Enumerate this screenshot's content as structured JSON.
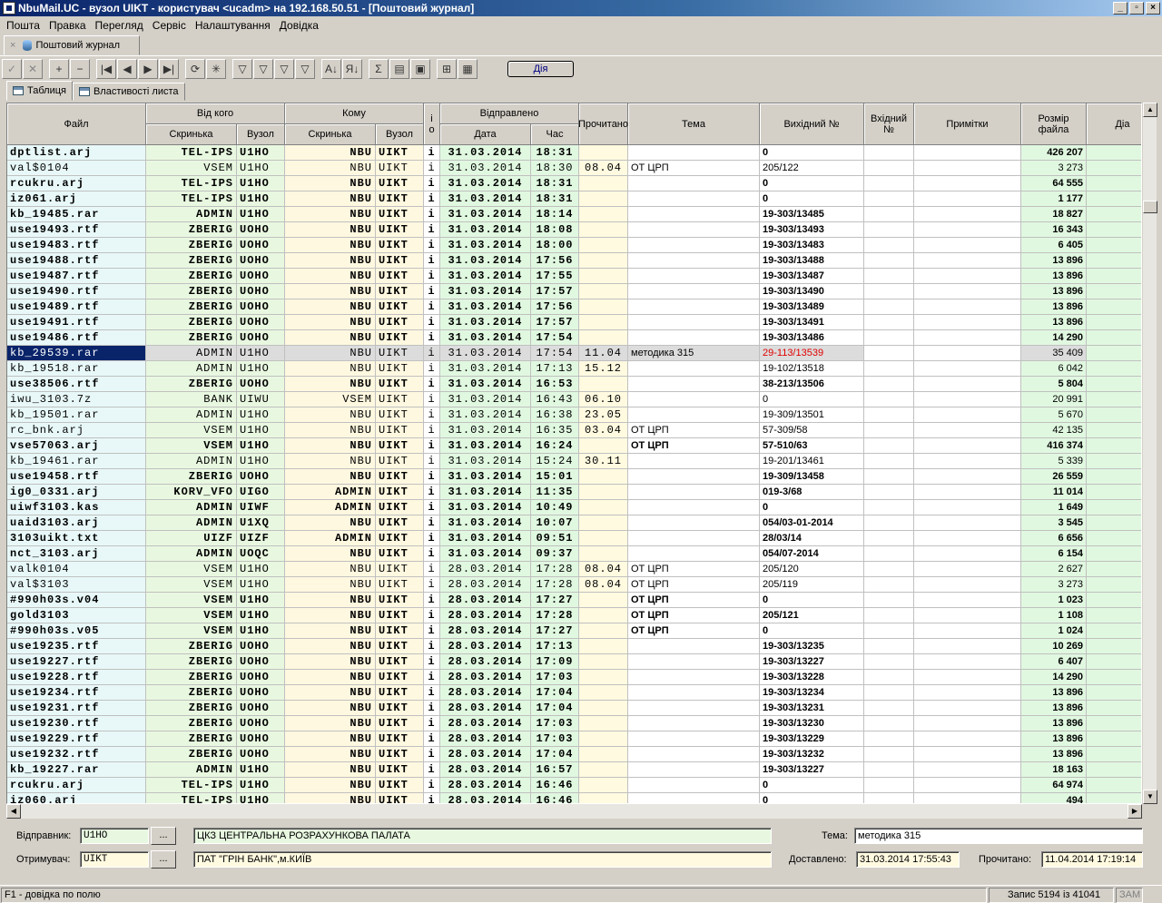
{
  "window": {
    "title": "NbuMail.UC - вузол UIKT - користувач <ucadm> на 192.168.50.51 - [Поштовий журнал]",
    "buttons": [
      "_",
      "▫",
      "×"
    ]
  },
  "menu": [
    "Пошта",
    "Правка",
    "Перегляд",
    "Сервіс",
    "Налаштування",
    "Довідка"
  ],
  "doc_tab": {
    "close": "×",
    "label": "Поштовий журнал"
  },
  "toolbar": {
    "buttons": [
      {
        "icon": "check-icon",
        "glyph": "✓"
      },
      {
        "icon": "cancel-icon",
        "glyph": "✕"
      },
      {
        "icon": "plus-icon",
        "glyph": "+"
      },
      {
        "icon": "minus-icon",
        "glyph": "−"
      },
      {
        "icon": "first-icon",
        "glyph": "|◀"
      },
      {
        "icon": "prev-icon",
        "glyph": "◀"
      },
      {
        "icon": "next-icon",
        "glyph": "▶"
      },
      {
        "icon": "last-icon",
        "glyph": "▶|"
      },
      {
        "icon": "refresh-icon",
        "glyph": "⟳"
      },
      {
        "icon": "star-icon",
        "glyph": "✳"
      },
      {
        "icon": "filter-icon",
        "glyph": "▽"
      },
      {
        "icon": "filter-clear-icon",
        "glyph": "▽"
      },
      {
        "icon": "filter-edit-icon",
        "glyph": "▽"
      },
      {
        "icon": "filter-set-icon",
        "glyph": "▽"
      },
      {
        "icon": "sort-asc-icon",
        "glyph": "A↓"
      },
      {
        "icon": "sort-desc-icon",
        "glyph": "Я↓"
      },
      {
        "icon": "sum-icon",
        "glyph": "Σ"
      },
      {
        "icon": "properties-icon",
        "glyph": "▤"
      },
      {
        "icon": "save-icon",
        "glyph": "▣"
      },
      {
        "icon": "export-icon",
        "glyph": "⊞"
      },
      {
        "icon": "grid-icon",
        "glyph": "▦"
      }
    ],
    "action_label": "Дія"
  },
  "view_tabs": [
    "Таблиця",
    "Властивості листа"
  ],
  "columns": {
    "file": "Файл",
    "from": "Від кого",
    "to": "Кому",
    "io": "і о",
    "sent": "Відправлено",
    "read": "Прочитано",
    "subject": "Тема",
    "out_no": "Вихідний №",
    "in_no": "Вхідний №",
    "notes": "Примітки",
    "size": "Розмір файла",
    "dia": "Діа",
    "box": "Скринька",
    "node": "Вузол",
    "date": "Дата",
    "time": "Час"
  },
  "rows": [
    [
      "dptlist.arj",
      "TEL-IPS",
      "U1HO",
      "NBU",
      "UIKT",
      "i",
      "31.03.2014",
      "18:31",
      "",
      "",
      "0",
      "426 207"
    ],
    [
      "val$0104",
      "VSEM",
      "U1HO",
      "NBU",
      "UIKT",
      "i",
      "31.03.2014",
      "18:30",
      "08.04",
      "ОТ ЦРП",
      "205/122",
      "3 273"
    ],
    [
      "rcukru.arj",
      "TEL-IPS",
      "U1HO",
      "NBU",
      "UIKT",
      "i",
      "31.03.2014",
      "18:31",
      "",
      "",
      "0",
      "64 555"
    ],
    [
      "iz061.arj",
      "TEL-IPS",
      "U1HO",
      "NBU",
      "UIKT",
      "i",
      "31.03.2014",
      "18:31",
      "",
      "",
      "0",
      "1 177"
    ],
    [
      "kb_19485.rar",
      "ADMIN",
      "U1HO",
      "NBU",
      "UIKT",
      "i",
      "31.03.2014",
      "18:14",
      "",
      "",
      "19-303/13485",
      "18 827"
    ],
    [
      "use19493.rtf",
      "ZBERIG",
      "UOHO",
      "NBU",
      "UIKT",
      "i",
      "31.03.2014",
      "18:08",
      "",
      "",
      "19-303/13493",
      "16 343"
    ],
    [
      "use19483.rtf",
      "ZBERIG",
      "UOHO",
      "NBU",
      "UIKT",
      "i",
      "31.03.2014",
      "18:00",
      "",
      "",
      "19-303/13483",
      "6 405"
    ],
    [
      "use19488.rtf",
      "ZBERIG",
      "UOHO",
      "NBU",
      "UIKT",
      "i",
      "31.03.2014",
      "17:56",
      "",
      "",
      "19-303/13488",
      "13 896"
    ],
    [
      "use19487.rtf",
      "ZBERIG",
      "UOHO",
      "NBU",
      "UIKT",
      "i",
      "31.03.2014",
      "17:55",
      "",
      "",
      "19-303/13487",
      "13 896"
    ],
    [
      "use19490.rtf",
      "ZBERIG",
      "UOHO",
      "NBU",
      "UIKT",
      "i",
      "31.03.2014",
      "17:57",
      "",
      "",
      "19-303/13490",
      "13 896"
    ],
    [
      "use19489.rtf",
      "ZBERIG",
      "UOHO",
      "NBU",
      "UIKT",
      "i",
      "31.03.2014",
      "17:56",
      "",
      "",
      "19-303/13489",
      "13 896"
    ],
    [
      "use19491.rtf",
      "ZBERIG",
      "UOHO",
      "NBU",
      "UIKT",
      "i",
      "31.03.2014",
      "17:57",
      "",
      "",
      "19-303/13491",
      "13 896"
    ],
    [
      "use19486.rtf",
      "ZBERIG",
      "UOHO",
      "NBU",
      "UIKT",
      "i",
      "31.03.2014",
      "17:54",
      "",
      "",
      "19-303/13486",
      "14 290"
    ],
    [
      "kb_29539.rar",
      "ADMIN",
      "U1HO",
      "NBU",
      "UIKT",
      "i",
      "31.03.2014",
      "17:54",
      "11.04",
      "методика 315",
      "29-113/13539",
      "35 409"
    ],
    [
      "kb_19518.rar",
      "ADMIN",
      "U1HO",
      "NBU",
      "UIKT",
      "i",
      "31.03.2014",
      "17:13",
      "15.12",
      "",
      "19-102/13518",
      "6 042"
    ],
    [
      "use38506.rtf",
      "ZBERIG",
      "UOHO",
      "NBU",
      "UIKT",
      "i",
      "31.03.2014",
      "16:53",
      "",
      "",
      "38-213/13506",
      "5 804"
    ],
    [
      "iwu_3103.7z",
      "BANK",
      "UIWU",
      "VSEM",
      "UIKT",
      "i",
      "31.03.2014",
      "16:43",
      "06.10",
      "",
      "0",
      "20 991"
    ],
    [
      "kb_19501.rar",
      "ADMIN",
      "U1HO",
      "NBU",
      "UIKT",
      "i",
      "31.03.2014",
      "16:38",
      "23.05",
      "",
      "19-309/13501",
      "5 670"
    ],
    [
      "rc_bnk.arj",
      "VSEM",
      "U1HO",
      "NBU",
      "UIKT",
      "i",
      "31.03.2014",
      "16:35",
      "03.04",
      "ОТ ЦРП",
      "57-309/58",
      "42 135"
    ],
    [
      "vse57063.arj",
      "VSEM",
      "U1HO",
      "NBU",
      "UIKT",
      "i",
      "31.03.2014",
      "16:24",
      "",
      "ОТ ЦРП",
      "57-510/63",
      "416 374"
    ],
    [
      "kb_19461.rar",
      "ADMIN",
      "U1HO",
      "NBU",
      "UIKT",
      "i",
      "31.03.2014",
      "15:24",
      "30.11",
      "",
      "19-201/13461",
      "5 339"
    ],
    [
      "use19458.rtf",
      "ZBERIG",
      "UOHO",
      "NBU",
      "UIKT",
      "i",
      "31.03.2014",
      "15:01",
      "",
      "",
      "19-309/13458",
      "26 559"
    ],
    [
      "ig0_0331.arj",
      "KORV_VFO",
      "UIGO",
      "ADMIN",
      "UIKT",
      "i",
      "31.03.2014",
      "11:35",
      "",
      "",
      "019-3/68",
      "11 014"
    ],
    [
      "uiwf3103.kas",
      "ADMIN",
      "UIWF",
      "ADMIN",
      "UIKT",
      "i",
      "31.03.2014",
      "10:49",
      "",
      "",
      "0",
      "1 649"
    ],
    [
      "uaid3103.arj",
      "ADMIN",
      "U1XQ",
      "NBU",
      "UIKT",
      "i",
      "31.03.2014",
      "10:07",
      "",
      "",
      "054/03-01-2014",
      "3 545"
    ],
    [
      "3103uikt.txt",
      "UIZF",
      "UIZF",
      "ADMIN",
      "UIKT",
      "i",
      "31.03.2014",
      "09:51",
      "",
      "",
      "28/03/14",
      "6 656"
    ],
    [
      "nct_3103.arj",
      "ADMIN",
      "UOQC",
      "NBU",
      "UIKT",
      "i",
      "31.03.2014",
      "09:37",
      "",
      "",
      "054/07-2014",
      "6 154"
    ],
    [
      "valk0104",
      "VSEM",
      "U1HO",
      "NBU",
      "UIKT",
      "i",
      "28.03.2014",
      "17:28",
      "08.04",
      "ОТ ЦРП",
      "205/120",
      "2 627"
    ],
    [
      "val$3103",
      "VSEM",
      "U1HO",
      "NBU",
      "UIKT",
      "i",
      "28.03.2014",
      "17:28",
      "08.04",
      "ОТ ЦРП",
      "205/119",
      "3 273"
    ],
    [
      "#990h03s.v04",
      "VSEM",
      "U1HO",
      "NBU",
      "UIKT",
      "i",
      "28.03.2014",
      "17:27",
      "",
      "ОТ ЦРП",
      "0",
      "1 023"
    ],
    [
      "gold3103",
      "VSEM",
      "U1HO",
      "NBU",
      "UIKT",
      "i",
      "28.03.2014",
      "17:28",
      "",
      "ОТ ЦРП",
      "205/121",
      "1 108"
    ],
    [
      "#990h03s.v05",
      "VSEM",
      "U1HO",
      "NBU",
      "UIKT",
      "i",
      "28.03.2014",
      "17:27",
      "",
      "ОТ ЦРП",
      "0",
      "1 024"
    ],
    [
      "use19235.rtf",
      "ZBERIG",
      "UOHO",
      "NBU",
      "UIKT",
      "i",
      "28.03.2014",
      "17:13",
      "",
      "",
      "19-303/13235",
      "10 269"
    ],
    [
      "use19227.rtf",
      "ZBERIG",
      "UOHO",
      "NBU",
      "UIKT",
      "i",
      "28.03.2014",
      "17:09",
      "",
      "",
      "19-303/13227",
      "6 407"
    ],
    [
      "use19228.rtf",
      "ZBERIG",
      "UOHO",
      "NBU",
      "UIKT",
      "i",
      "28.03.2014",
      "17:03",
      "",
      "",
      "19-303/13228",
      "14 290"
    ],
    [
      "use19234.rtf",
      "ZBERIG",
      "UOHO",
      "NBU",
      "UIKT",
      "i",
      "28.03.2014",
      "17:04",
      "",
      "",
      "19-303/13234",
      "13 896"
    ],
    [
      "use19231.rtf",
      "ZBERIG",
      "UOHO",
      "NBU",
      "UIKT",
      "i",
      "28.03.2014",
      "17:04",
      "",
      "",
      "19-303/13231",
      "13 896"
    ],
    [
      "use19230.rtf",
      "ZBERIG",
      "UOHO",
      "NBU",
      "UIKT",
      "i",
      "28.03.2014",
      "17:03",
      "",
      "",
      "19-303/13230",
      "13 896"
    ],
    [
      "use19229.rtf",
      "ZBERIG",
      "UOHO",
      "NBU",
      "UIKT",
      "i",
      "28.03.2014",
      "17:03",
      "",
      "",
      "19-303/13229",
      "13 896"
    ],
    [
      "use19232.rtf",
      "ZBERIG",
      "UOHO",
      "NBU",
      "UIKT",
      "i",
      "28.03.2014",
      "17:04",
      "",
      "",
      "19-303/13232",
      "13 896"
    ],
    [
      "kb_19227.rar",
      "ADMIN",
      "U1HO",
      "NBU",
      "UIKT",
      "i",
      "28.03.2014",
      "16:57",
      "",
      "",
      "19-303/13227",
      "18 163"
    ],
    [
      "rcukru.arj",
      "TEL-IPS",
      "U1HO",
      "NBU",
      "UIKT",
      "i",
      "28.03.2014",
      "16:46",
      "",
      "",
      "0",
      "64 974"
    ],
    [
      "iz060.arj",
      "TEL-IPS",
      "U1HO",
      "NBU",
      "UIKT",
      "i",
      "28.03.2014",
      "16:46",
      "",
      "",
      "0",
      "494"
    ]
  ],
  "normal_weight_rows": [
    1,
    13,
    14,
    16,
    17,
    18,
    20,
    27,
    28
  ],
  "selected_row": 13,
  "details": {
    "sender_label": "Відправник:",
    "sender_code": "U1HO",
    "sender_name": "ЦКЗ ЦЕНТРАЛЬНА РОЗРАХУНКОВА ПАЛАТА",
    "receiver_label": "Отримувач:",
    "receiver_code": "UIKT",
    "receiver_name": "ПАТ \"ГРІН БАНК\",м.КИЇВ",
    "browse": "...",
    "subject_label": "Тема:",
    "subject_value": "методика 315",
    "delivered_label": "Доставлено:",
    "delivered_value": "31.03.2014 17:55:43",
    "read_label": "Прочитано:",
    "read_value": "11.04.2014 17:19:14"
  },
  "status": {
    "hint": "F1 - довідка по полю",
    "record": "Запис 5194 із 41041",
    "mode": "ЗАМ"
  },
  "colors": {
    "file_col": "#e8f8f8",
    "from_col": "#e8f8e0",
    "to_col": "#fff8e0",
    "sent_col": "#e0f8e0",
    "read_col": "#fffae0",
    "size_col": "#e0f8e0",
    "selected": "#0a246a",
    "red_text": "#e00000"
  }
}
